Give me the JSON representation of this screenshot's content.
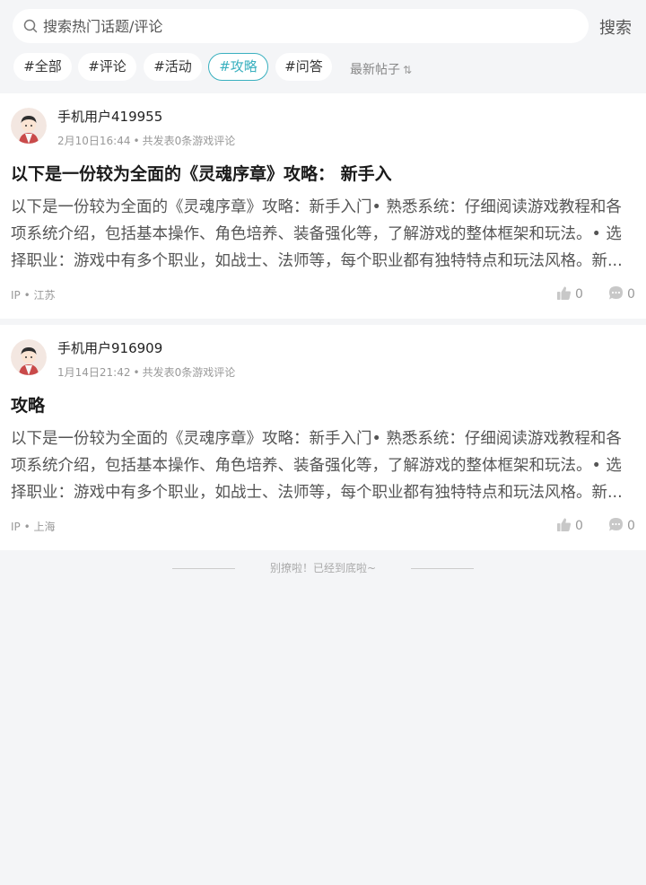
{
  "search": {
    "placeholder": "搜索热门话题/评论",
    "button_label": "搜索"
  },
  "tabs": [
    {
      "label": "#全部",
      "active": false
    },
    {
      "label": "#评论",
      "active": false
    },
    {
      "label": "#活动",
      "active": false
    },
    {
      "label": "#攻略",
      "active": true
    },
    {
      "label": "#问答",
      "active": false
    }
  ],
  "sort": {
    "label": "最新帖子",
    "icon": "sort-arrows-icon"
  },
  "posts": [
    {
      "username": "手机用户419955",
      "date": "2月10日16:44",
      "stats": "共发表0条游戏评论",
      "title": "以下是一份较为全面的《灵魂序章》攻略： 新手入",
      "body": "以下是一份较为全面的《灵魂序章》攻略：新手入门• 熟悉系统：仔细阅读游戏教程和各项系统介绍，包括基本操作、角色培养、装备强化等，了解游戏的整体框架和玩法。• 选择职业：游戏中有多个职业，如战士、法师等，每个职业都有独特特点和玩法风格。新...",
      "ip_label": "IP",
      "ip_location": "江苏",
      "likes": "0",
      "comments": "0"
    },
    {
      "username": "手机用户916909",
      "date": "1月14日21:42",
      "stats": "共发表0条游戏评论",
      "title": "攻略",
      "body": "以下是一份较为全面的《灵魂序章》攻略：新手入门• 熟悉系统：仔细阅读游戏教程和各项系统介绍，包括基本操作、角色培养、装备强化等，了解游戏的整体框架和玩法。• 选择职业：游戏中有多个职业，如战士、法师等，每个职业都有独特特点和玩法风格。新...",
      "ip_label": "IP",
      "ip_location": "上海",
      "likes": "0",
      "comments": "0"
    }
  ],
  "footer": {
    "end_text": "别撩啦！已经到底啦~"
  },
  "colors": {
    "accent": "#39b0bf",
    "background": "#f4f5f7"
  }
}
